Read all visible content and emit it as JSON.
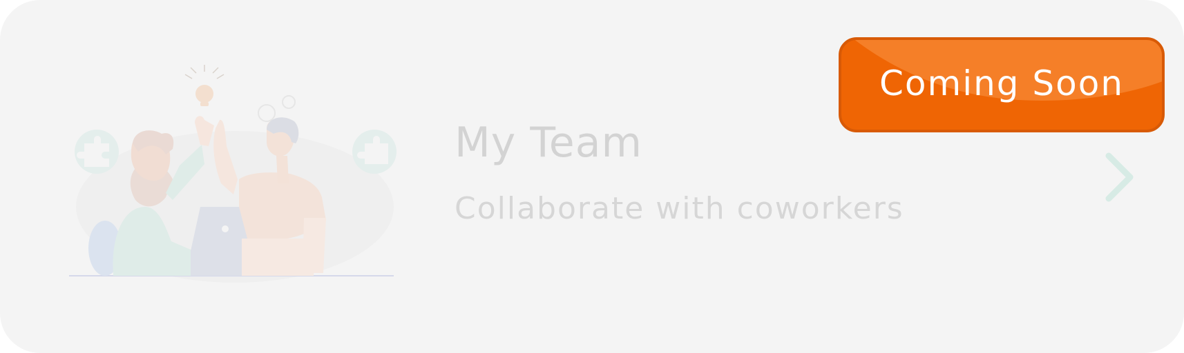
{
  "card": {
    "title": "My Team",
    "subtitle": "Collaborate with coworkers"
  },
  "badge": {
    "label": "Coming Soon",
    "color": "#ef6504"
  },
  "illustration": {
    "name": "team-high-five-illustration"
  },
  "icons": {
    "chevron": "chevron-right-icon"
  },
  "colors": {
    "card_background": "#f4f4f4",
    "title": "#d3d3d3",
    "subtitle": "#d6d6d6",
    "chevron": "#d7ebe5",
    "badge_text": "#ffffff"
  }
}
